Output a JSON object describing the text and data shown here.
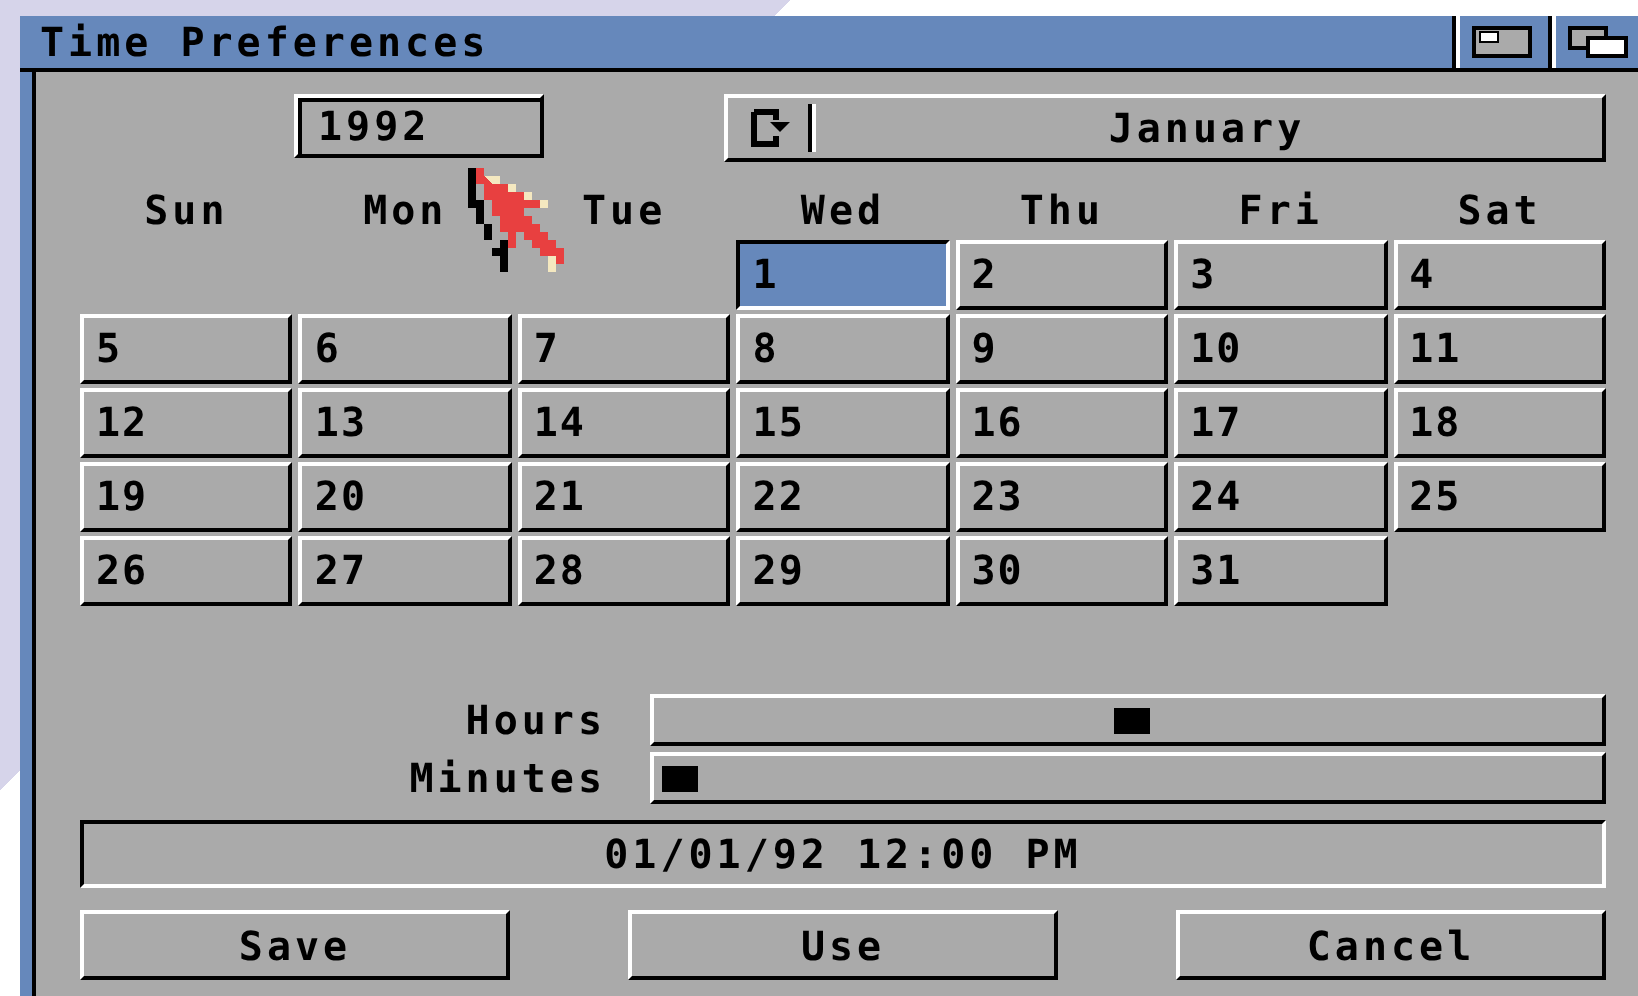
{
  "window": {
    "title": "Time Preferences"
  },
  "year": {
    "value": "1992"
  },
  "month": {
    "label": "January"
  },
  "weekdays": [
    "Sun",
    "Mon",
    "Tue",
    "Wed",
    "Thu",
    "Fri",
    "Sat"
  ],
  "weeks": [
    [
      {
        "kind": "blank"
      },
      {
        "kind": "blank"
      },
      {
        "kind": "blank"
      },
      {
        "day": "1",
        "selected": true
      },
      {
        "day": "2",
        "selected": false
      },
      {
        "day": "3",
        "selected": false
      },
      {
        "day": "4",
        "selected": false
      }
    ],
    [
      {
        "day": "5",
        "selected": false
      },
      {
        "day": "6",
        "selected": false
      },
      {
        "day": "7",
        "selected": false
      },
      {
        "day": "8",
        "selected": false
      },
      {
        "day": "9",
        "selected": false
      },
      {
        "day": "10",
        "selected": false
      },
      {
        "day": "11",
        "selected": false
      }
    ],
    [
      {
        "day": "12",
        "selected": false
      },
      {
        "day": "13",
        "selected": false
      },
      {
        "day": "14",
        "selected": false
      },
      {
        "day": "15",
        "selected": false
      },
      {
        "day": "16",
        "selected": false
      },
      {
        "day": "17",
        "selected": false
      },
      {
        "day": "18",
        "selected": false
      }
    ],
    [
      {
        "day": "19",
        "selected": false
      },
      {
        "day": "20",
        "selected": false
      },
      {
        "day": "21",
        "selected": false
      },
      {
        "day": "22",
        "selected": false
      },
      {
        "day": "23",
        "selected": false
      },
      {
        "day": "24",
        "selected": false
      },
      {
        "day": "25",
        "selected": false
      }
    ],
    [
      {
        "day": "26",
        "selected": false
      },
      {
        "day": "27",
        "selected": false
      },
      {
        "day": "28",
        "selected": false
      },
      {
        "day": "29",
        "selected": false
      },
      {
        "day": "30",
        "selected": false
      },
      {
        "day": "31",
        "selected": false
      },
      {
        "kind": "blank"
      }
    ]
  ],
  "sliders": [
    {
      "label": "Hours",
      "level": 0.5
    },
    {
      "label": "Minutes",
      "level": 0
    }
  ],
  "datetime": "01/01/92 12:00 PM",
  "buttons": [
    "Save",
    "Use",
    "Cancel"
  ]
}
